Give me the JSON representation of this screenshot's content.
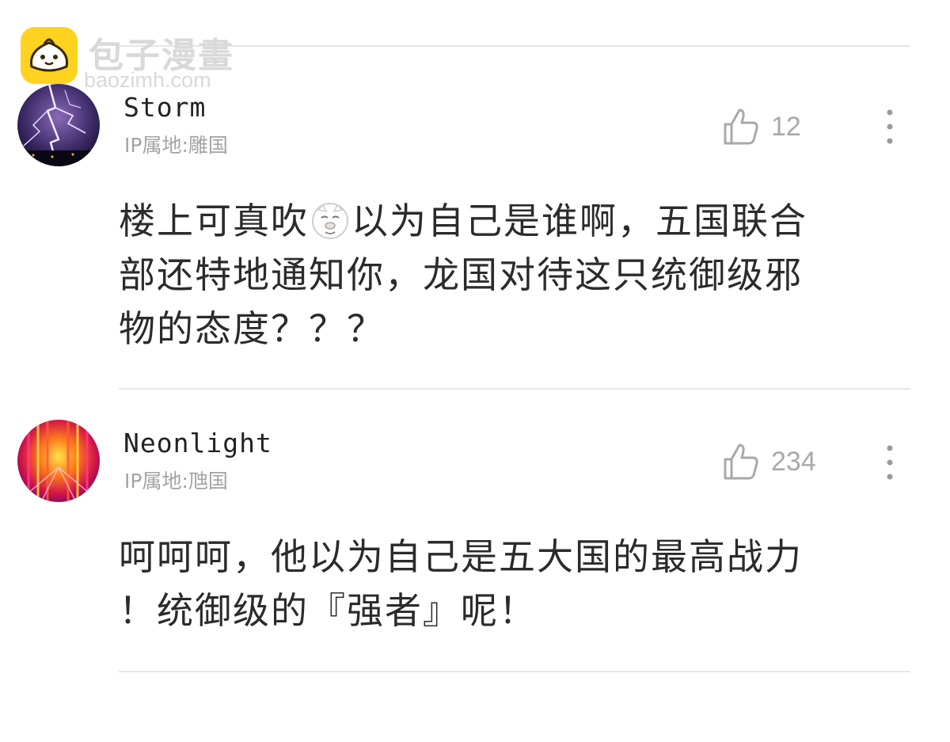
{
  "watermark": {
    "name": "包子漫畫",
    "url": "baozimh.com"
  },
  "comments": [
    {
      "username": "Storm",
      "location": "IP属地:雕国",
      "likes": "12",
      "avatar": "lightning-avatar",
      "text_line1_part1": "楼上可真吹",
      "emoji": "smug-face-emoji",
      "text_line1_part2": "以为自己是谁啊，五国联合",
      "text_line2": "部还特地通知你，龙国对待这只统御级邪",
      "text_line3": "物的态度？？？"
    },
    {
      "username": "Neonlight",
      "location": "IP属地:虺国",
      "likes": "234",
      "avatar": "neon-light-avatar",
      "text_line1": "呵呵呵，他以为自己是五大国的最高战力",
      "text_line2": "！统御级的『强者』呢！"
    }
  ],
  "icons": {
    "like": "thumbs-up-icon",
    "more": "more-vertical-icon"
  },
  "colors": {
    "watermark_logo": "#ffd21f",
    "muted_text": "#a3a3a3",
    "divider": "#e6e6e6"
  }
}
